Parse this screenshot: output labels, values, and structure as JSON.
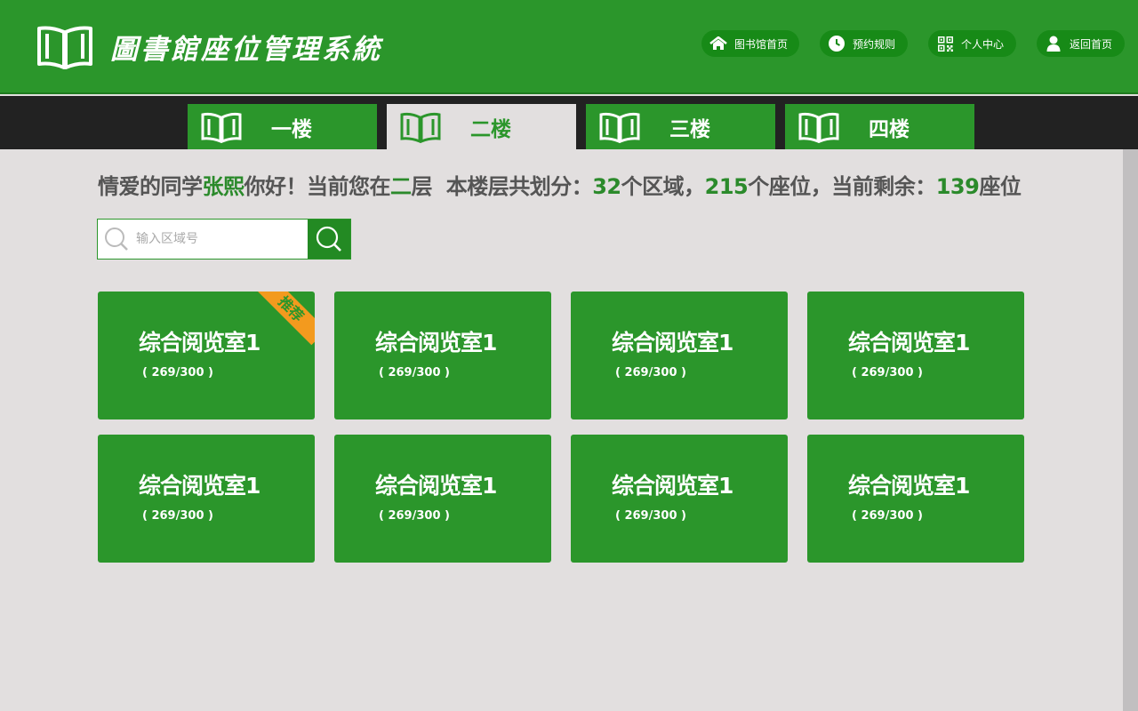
{
  "header": {
    "title": "圖書館座位管理系統",
    "nav": [
      {
        "label": "图书馆首页",
        "icon": "home-icon"
      },
      {
        "label": "预约规则",
        "icon": "clock-icon"
      },
      {
        "label": "个人中心",
        "icon": "qr-code-icon"
      },
      {
        "label": "返回首页",
        "icon": "user-icon"
      }
    ]
  },
  "floors": {
    "tabs": [
      {
        "label": "一楼",
        "active": false
      },
      {
        "label": "二楼",
        "active": true
      },
      {
        "label": "三楼",
        "active": false
      },
      {
        "label": "四楼",
        "active": false
      }
    ]
  },
  "info": {
    "greet_pre": "情爱的同学",
    "student_name": "张熙",
    "greet_mid": "你好！当前您在",
    "floor": "二",
    "floor_suffix": "层",
    "summary_pre": "本楼层共划分：",
    "areas": "32",
    "areas_suffix": "个区域，",
    "seats": "215",
    "seats_suffix": "个座位，当前剩余：",
    "remaining": "139",
    "remaining_suffix": "座位"
  },
  "search": {
    "placeholder": "输入区域号"
  },
  "rooms": [
    {
      "name": "综合阅览室1",
      "count": "( 269/300 )",
      "badge": "推荐"
    },
    {
      "name": "综合阅览室1",
      "count": "( 269/300 )"
    },
    {
      "name": "综合阅览室1",
      "count": "( 269/300 )"
    },
    {
      "name": "综合阅览室1",
      "count": "( 269/300 )"
    },
    {
      "name": "综合阅览室1",
      "count": "( 269/300 )"
    },
    {
      "name": "综合阅览室1",
      "count": "( 269/300 )"
    },
    {
      "name": "综合阅览室1",
      "count": "( 269/300 )"
    },
    {
      "name": "综合阅览室1",
      "count": "( 269/300 )"
    }
  ],
  "colors": {
    "primary": "#2b962b",
    "dark_bar": "#222222",
    "badge": "#f39a1e",
    "background": "#e2dfdf"
  }
}
